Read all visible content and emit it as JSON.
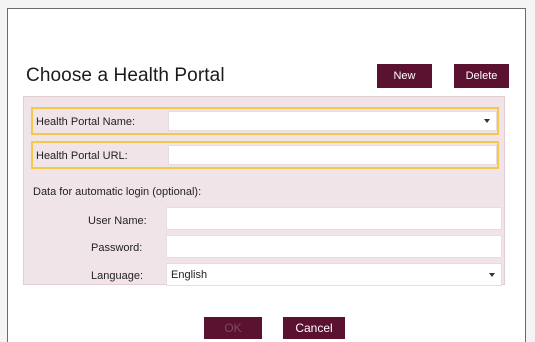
{
  "dialog": {
    "title": "Choose a Health Portal",
    "new_label": "New",
    "delete_label": "Delete"
  },
  "form": {
    "portal_name_label": "Health Portal Name:",
    "portal_name_value": "",
    "portal_url_label": "Health Portal URL:",
    "portal_url_value": "",
    "optional_label": "Data for automatic login (optional):",
    "username_label": "User Name:",
    "username_value": "",
    "password_label": "Password:",
    "password_value": "",
    "language_label": "Language:",
    "language_value": "English"
  },
  "footer": {
    "ok_label": "OK",
    "cancel_label": "Cancel"
  },
  "colors": {
    "button_bg": "#5a1230",
    "panel_bg": "#f1e4e8",
    "highlight_border": "#f4c84a"
  },
  "icons": {
    "dropdown": "chevron-down-icon"
  }
}
